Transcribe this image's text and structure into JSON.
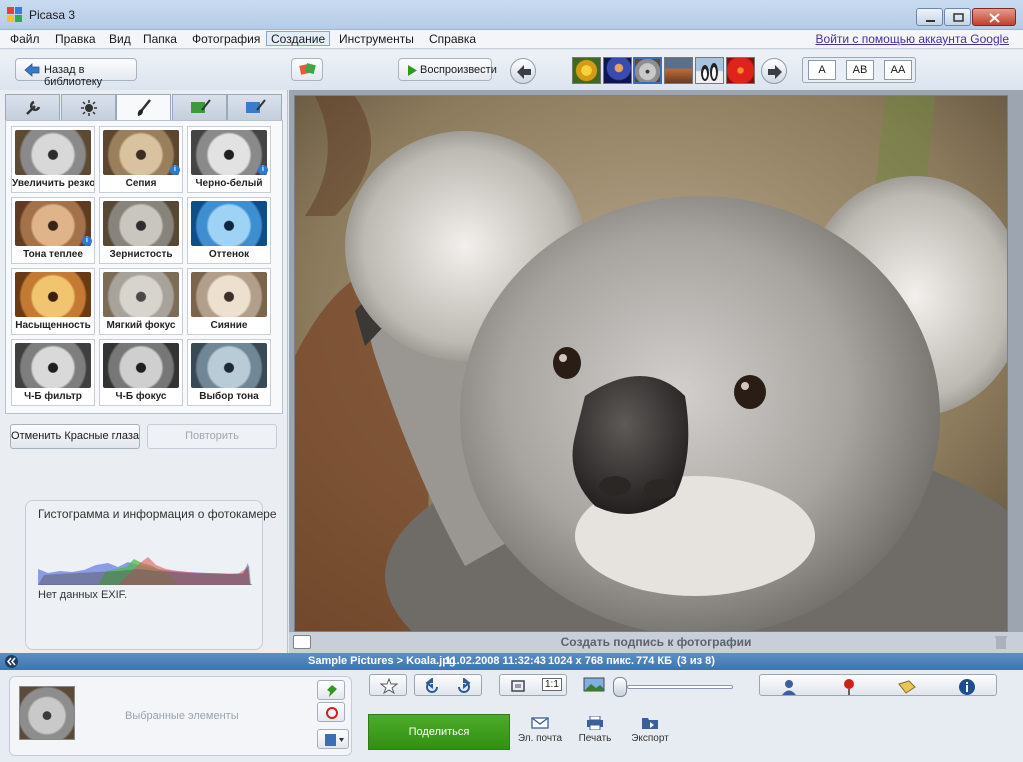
{
  "window": {
    "title": "Picasa 3"
  },
  "menu": {
    "items": [
      "Файл",
      "Правка",
      "Вид",
      "Папка",
      "Фотография",
      "Создание",
      "Инструменты",
      "Справка"
    ],
    "active_index": 5,
    "signin": "Войти с помощью аккаунта Google"
  },
  "toolbar": {
    "back_label": "Назад в библиотеку",
    "play_label": "Воспроизвести",
    "text_sizes": [
      "A",
      "AB",
      "AA"
    ]
  },
  "filmstrip": {
    "thumb_icons": [
      "flower-thumb",
      "jellyfish-thumb",
      "koala-thumb",
      "desert-thumb",
      "penguins-thumb",
      "chrysanthemum-thumb"
    ],
    "selected_index": 2
  },
  "effects_panel": {
    "tab_icons": [
      "wrench-icon",
      "sun-icon",
      "brush-icon",
      "green-brush-icon",
      "blue-brush-icon"
    ],
    "active_tab": 2,
    "effects": [
      {
        "label": "Увеличить резкость",
        "badge": ""
      },
      {
        "label": "Сепия",
        "badge": "i"
      },
      {
        "label": "Черно-белый",
        "badge": "i"
      },
      {
        "label": "Тона теплее",
        "badge": "i"
      },
      {
        "label": "Зернистость",
        "badge": ""
      },
      {
        "label": "Оттенок",
        "badge": ""
      },
      {
        "label": "Насыщенность",
        "badge": ""
      },
      {
        "label": "Мягкий фокус",
        "badge": ""
      },
      {
        "label": "Сияние",
        "badge": ""
      },
      {
        "label": "Ч-Б фильтр",
        "badge": ""
      },
      {
        "label": "Ч-Б фокус",
        "badge": ""
      },
      {
        "label": "Выбор тона",
        "badge": ""
      }
    ],
    "undo_label": "Отменить Красные глаза",
    "redo_label": "Повторить",
    "histogram_title": "Гистограмма и информация о фотокамере",
    "exif_text": "Нет данных EXIF."
  },
  "photo": {
    "caption_placeholder": "Создать подпись к фотографии"
  },
  "status": {
    "path": "Sample Pictures > Koala.jpg",
    "datetime": "11.02.2008 11:32:43",
    "dimensions": "1024 x 768 пикс.",
    "size": "774 КБ",
    "position": "(3 из 8)"
  },
  "tray": {
    "selected_label": "Выбранные элементы",
    "share_label": "Поделиться",
    "email_label": "Эл. почта",
    "print_label": "Печать",
    "export_label": "Экспорт",
    "zoom_1to1": "1:1"
  },
  "colors": {
    "accent": "#3f74ad",
    "share_green": "#3c9a1c",
    "title_bar": "#c9dbf0"
  }
}
